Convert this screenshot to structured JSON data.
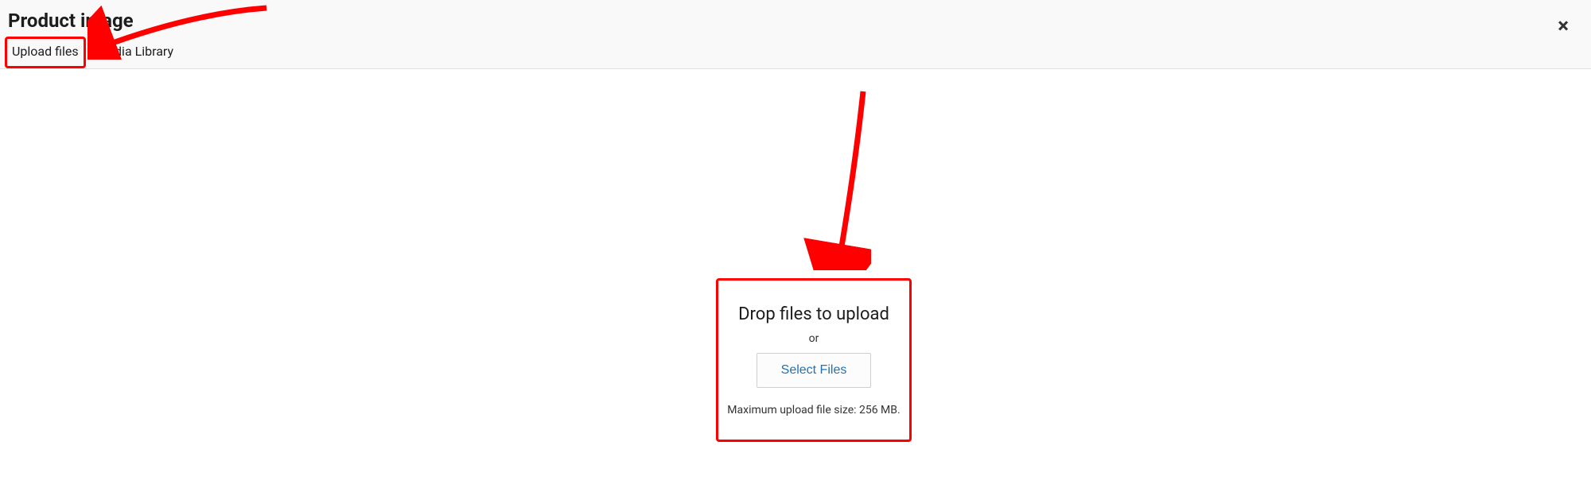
{
  "header": {
    "title": "Product image",
    "tabs": {
      "upload": "Upload files",
      "media_library": "Media Library"
    },
    "close_glyph": "×"
  },
  "upload": {
    "drop_title": "Drop files to upload",
    "or": "or",
    "select_button": "Select Files",
    "max_size": "Maximum upload file size: 256 MB."
  }
}
